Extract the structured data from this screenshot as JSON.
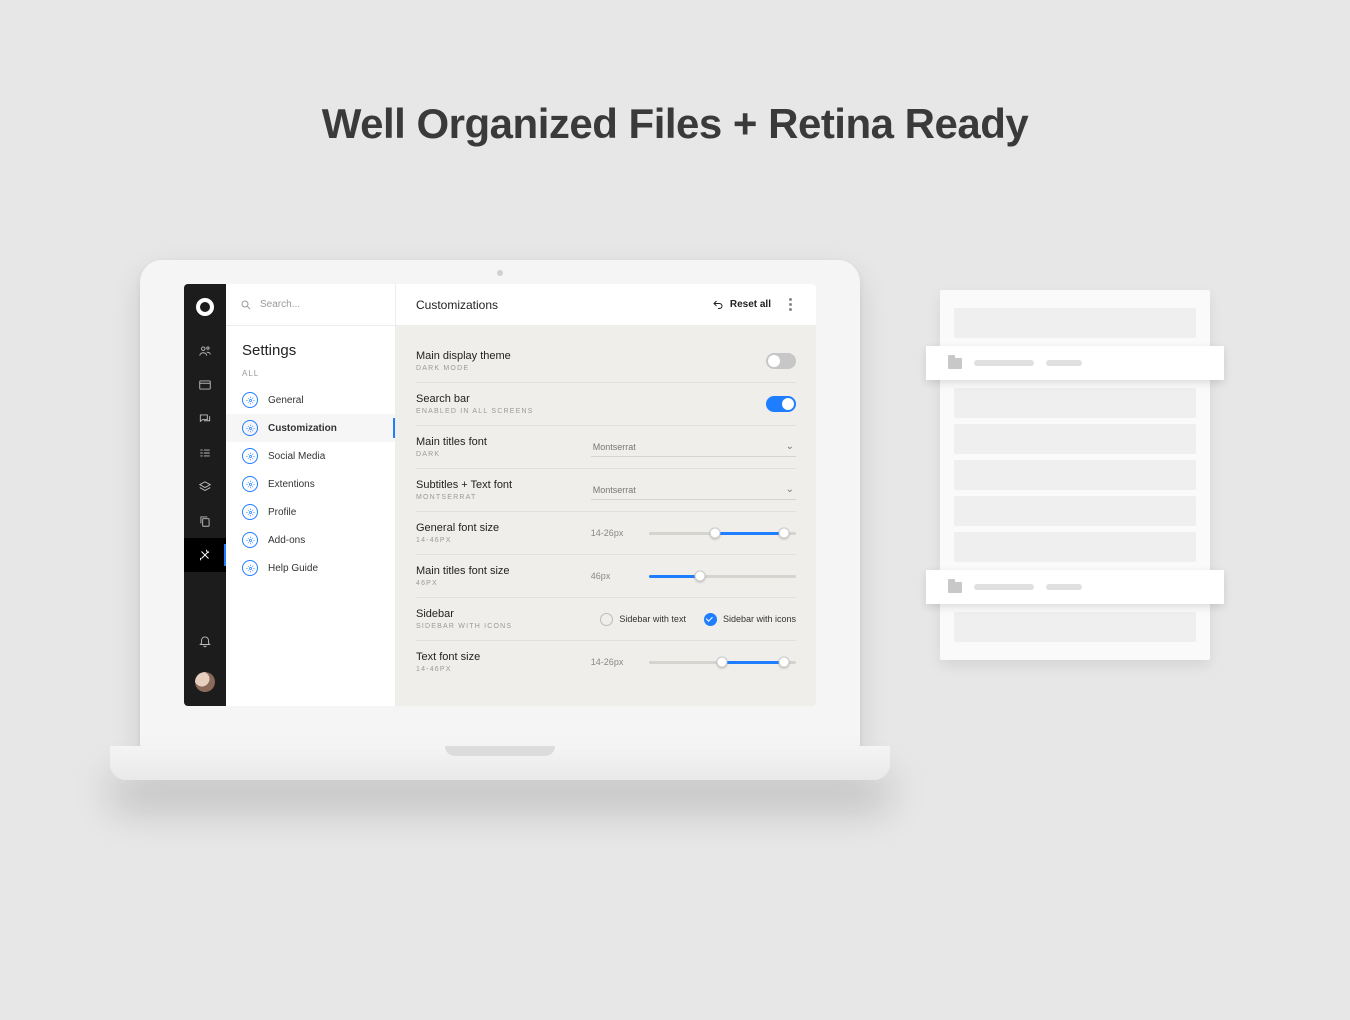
{
  "headline": "Well Organized Files + Retina Ready",
  "search": {
    "placeholder": "Search..."
  },
  "sidebar": {
    "title": "Settings",
    "category": "ALL",
    "items": [
      {
        "label": "General"
      },
      {
        "label": "Customization"
      },
      {
        "label": "Social Media"
      },
      {
        "label": "Extentions"
      },
      {
        "label": "Profile"
      },
      {
        "label": "Add-ons"
      },
      {
        "label": "Help Guide"
      }
    ],
    "active_index": 1
  },
  "rail": {
    "items": [
      "people",
      "browser",
      "chat",
      "list",
      "layers",
      "copy",
      "tools"
    ],
    "active_index": 6
  },
  "main": {
    "title": "Customizations",
    "reset_label": "Reset all",
    "rows": [
      {
        "title": "Main display theme",
        "sub": "DARK MODE",
        "type": "toggle",
        "value": false
      },
      {
        "title": "Search bar",
        "sub": "ENABLED IN ALL SCREENS",
        "type": "toggle",
        "value": true
      },
      {
        "title": "Main titles font",
        "sub": "DARK",
        "type": "select",
        "value": "Montserrat"
      },
      {
        "title": "Subtitles + Text font",
        "sub": "MONTSERRAT",
        "type": "select",
        "value": "Montserrat"
      },
      {
        "title": "General font size",
        "sub": "14-46PX",
        "type": "range",
        "label": "14-26px",
        "low": 45,
        "high": 92
      },
      {
        "title": "Main titles font size",
        "sub": "46PX",
        "type": "slider",
        "label": "46px",
        "pos": 35
      },
      {
        "title": "Sidebar",
        "sub": "SIDEBAR WITH ICONS",
        "type": "radio",
        "options": [
          "Sidebar with text",
          "Sidebar with icons"
        ],
        "selected": 1
      },
      {
        "title": "Text font size",
        "sub": "14-46PX",
        "type": "range",
        "label": "14-26px",
        "low": 50,
        "high": 92
      }
    ]
  },
  "colors": {
    "accent": "#1f7eff",
    "rail": "#1c1c1c",
    "page_bg": "#e7e7e7"
  }
}
